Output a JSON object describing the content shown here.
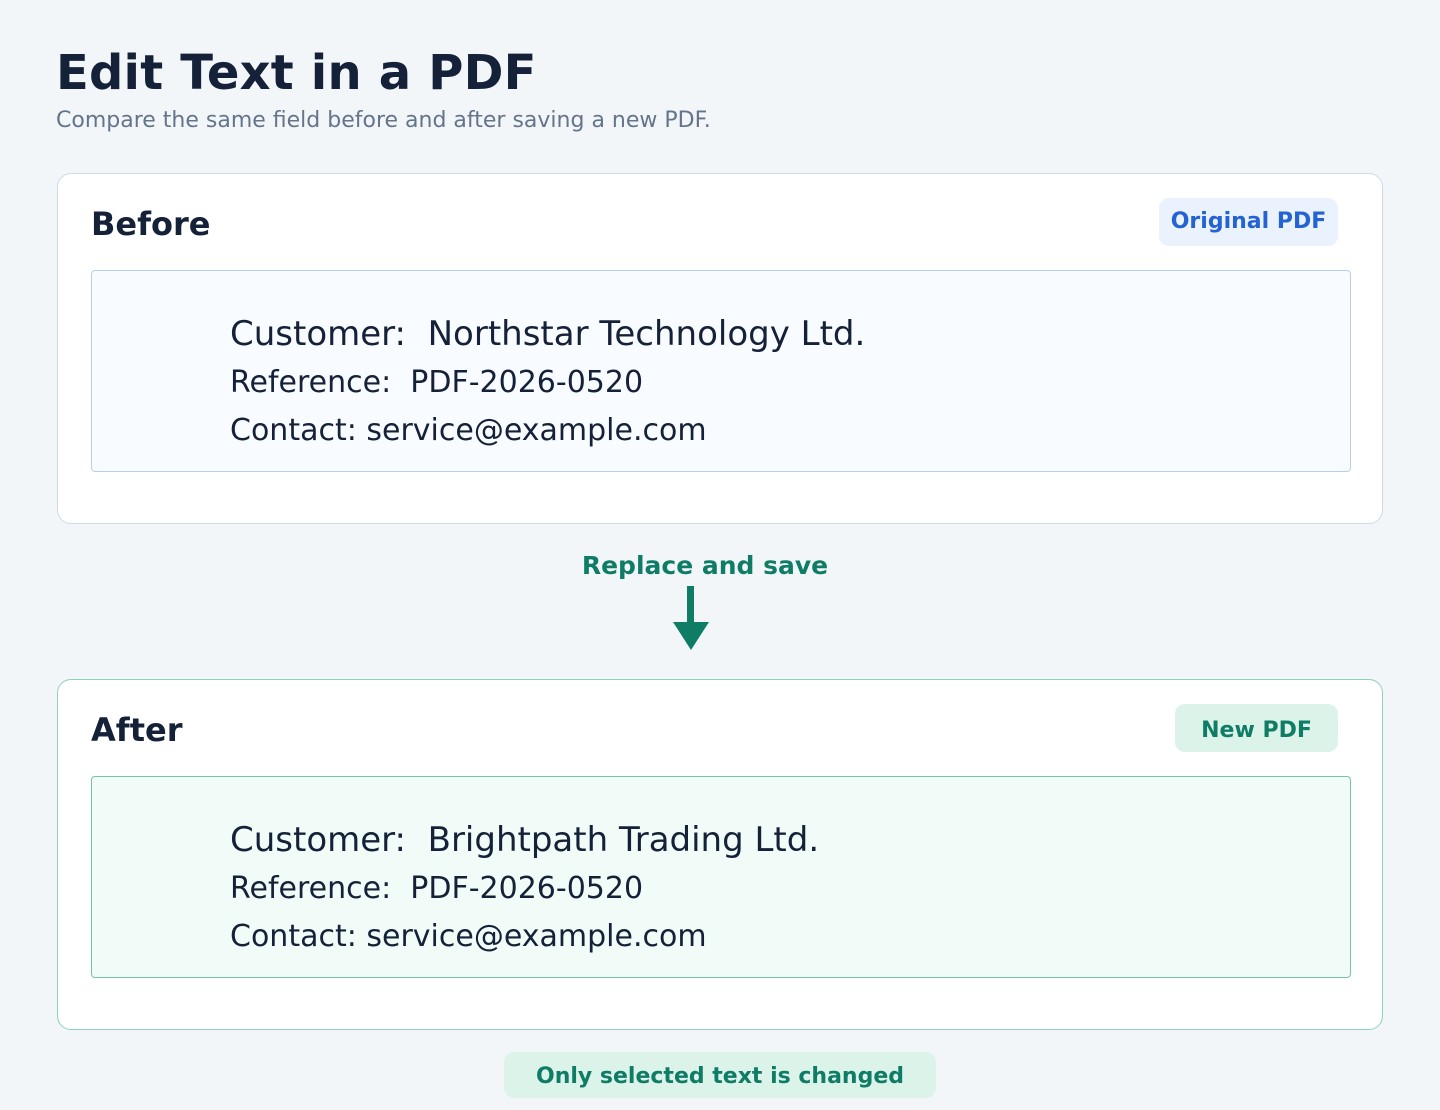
{
  "page": {
    "title": "Edit Text in a PDF",
    "subtitle": "Compare the same field before and after saving a new PDF."
  },
  "before": {
    "heading": "Before",
    "badge": "Original PDF",
    "lines": [
      "Customer:  Northstar Technology Ltd.",
      "Reference:  PDF-2026-0520",
      "Contact: service@example.com"
    ]
  },
  "flow": {
    "label": "Replace and save",
    "icon": "arrow-down-icon"
  },
  "after": {
    "heading": "After",
    "badge": "New PDF",
    "lines": [
      "Customer:  Brightpath Trading Ltd.",
      "Reference:  PDF-2026-0520",
      "Contact: service@example.com"
    ]
  },
  "footer": {
    "note": "Only selected text is changed"
  },
  "colors": {
    "background": "#f2f6f9",
    "accent_blue": "#2563d3",
    "accent_green": "#0f7c66",
    "heading": "#142138"
  }
}
